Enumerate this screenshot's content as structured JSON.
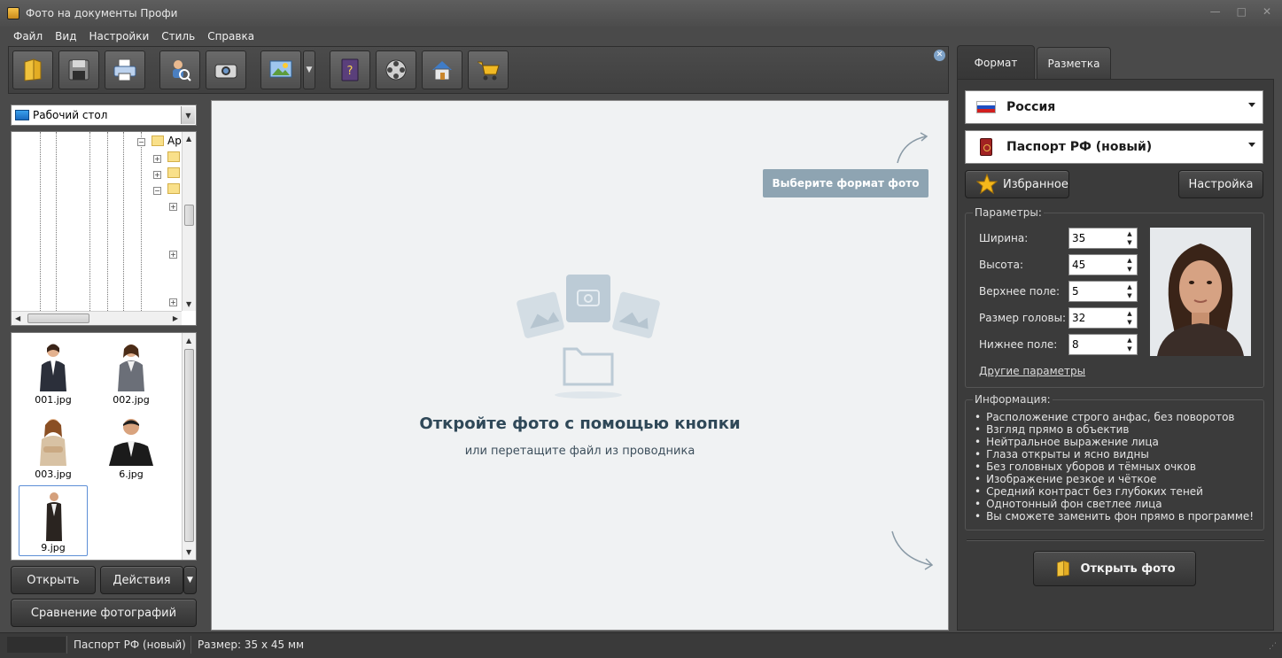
{
  "window": {
    "title": "Фото на документы Профи"
  },
  "menu": [
    "Файл",
    "Вид",
    "Настройки",
    "Стиль",
    "Справка"
  ],
  "toolbar": {
    "icons": [
      "open-folder-icon",
      "save-icon",
      "print-icon",
      "search-photo-icon",
      "camera-icon",
      "photo-editor-icon",
      "help-book-icon",
      "film-reel-icon",
      "home-icon",
      "shopping-cart-icon"
    ]
  },
  "left_panel": {
    "folder_combo": "Рабочий стол",
    "tree_partial_label": "Ap",
    "thumbnails": [
      {
        "file": "001.jpg"
      },
      {
        "file": "002.jpg"
      },
      {
        "file": "003.jpg"
      },
      {
        "file": "6.jpg"
      },
      {
        "file": "9.jpg",
        "selected": true
      }
    ],
    "open_button": "Открыть",
    "actions_button": "Действия",
    "compare_button": "Сравнение фотографий"
  },
  "center": {
    "hint": "Выберите формат фото",
    "empty_title": "Откройте фото с помощью кнопки",
    "empty_subtitle": "или перетащите файл из проводника"
  },
  "right_panel": {
    "tabs": [
      "Формат",
      "Разметка"
    ],
    "country": "Россия",
    "document": "Паспорт РФ (новый)",
    "favorites_button": "Избранное",
    "settings_button": "Настройка",
    "params_title": "Параметры:",
    "params": [
      {
        "label": "Ширина:",
        "value": "35"
      },
      {
        "label": "Высота:",
        "value": "45"
      },
      {
        "label": "Верхнее поле:",
        "value": "5"
      },
      {
        "label": "Размер головы:",
        "value": "32"
      },
      {
        "label": "Нижнее поле:",
        "value": "8"
      }
    ],
    "other_params_link": "Другие параметры",
    "info_title": "Информация:",
    "info_items": [
      "Расположение строго анфас, без поворотов",
      "Взгляд прямо в объектив",
      "Нейтральное выражение лица",
      "Глаза открыты и ясно видны",
      "Без головных уборов и тёмных очков",
      "Изображение резкое и чёткое",
      "Средний контраст без глубоких теней",
      "Однотонный фон светлее лица",
      "Вы сможете заменить фон прямо в программе!"
    ],
    "open_photo_button": "Открыть фото"
  },
  "status": {
    "format": "Паспорт РФ (новый)",
    "size": "Размер: 35 x 45 мм"
  },
  "colors": {
    "hint_bg": "#8ea4b2",
    "title_text": "#2f4858",
    "panel_bg": "#3b3b3b"
  }
}
